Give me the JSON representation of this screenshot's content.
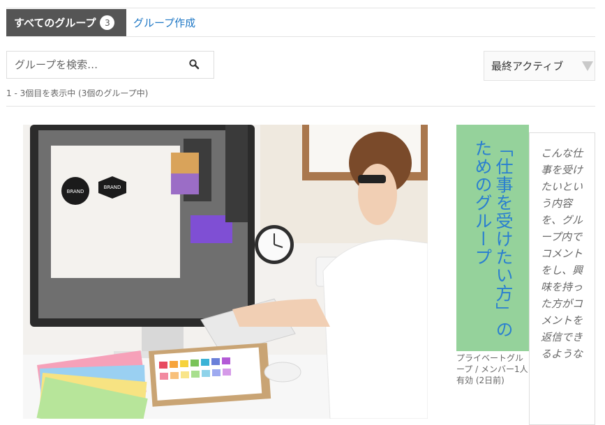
{
  "tabs": {
    "all_groups_label": "すべてのグループ",
    "all_groups_count": "3",
    "create_group_label": "グループ作成"
  },
  "search": {
    "placeholder": "グループを検索…",
    "icon": "search-icon"
  },
  "sort": {
    "selected": "最終アクティブ"
  },
  "pagination": {
    "summary": "1 - 3個目を表示中 (3個のグループ中)"
  },
  "groups": [
    {
      "title": "「仕事を受けたい方」のためのグループ",
      "meta_type": "プライベートグループ / メンバー1人",
      "meta_active": "有効 (2日前)",
      "description": "こんな仕事を受けたいという内容を、グループ内でコメントをし、興味を持った方がコメントを返信できるような",
      "image_label_1": "BRAND",
      "image_label_2": "BRAND"
    }
  ],
  "colors": {
    "tab_active_bg": "#555555",
    "link": "#1e77c5",
    "title_bg": "#95d29b",
    "title_text": "#2a7fd0"
  }
}
